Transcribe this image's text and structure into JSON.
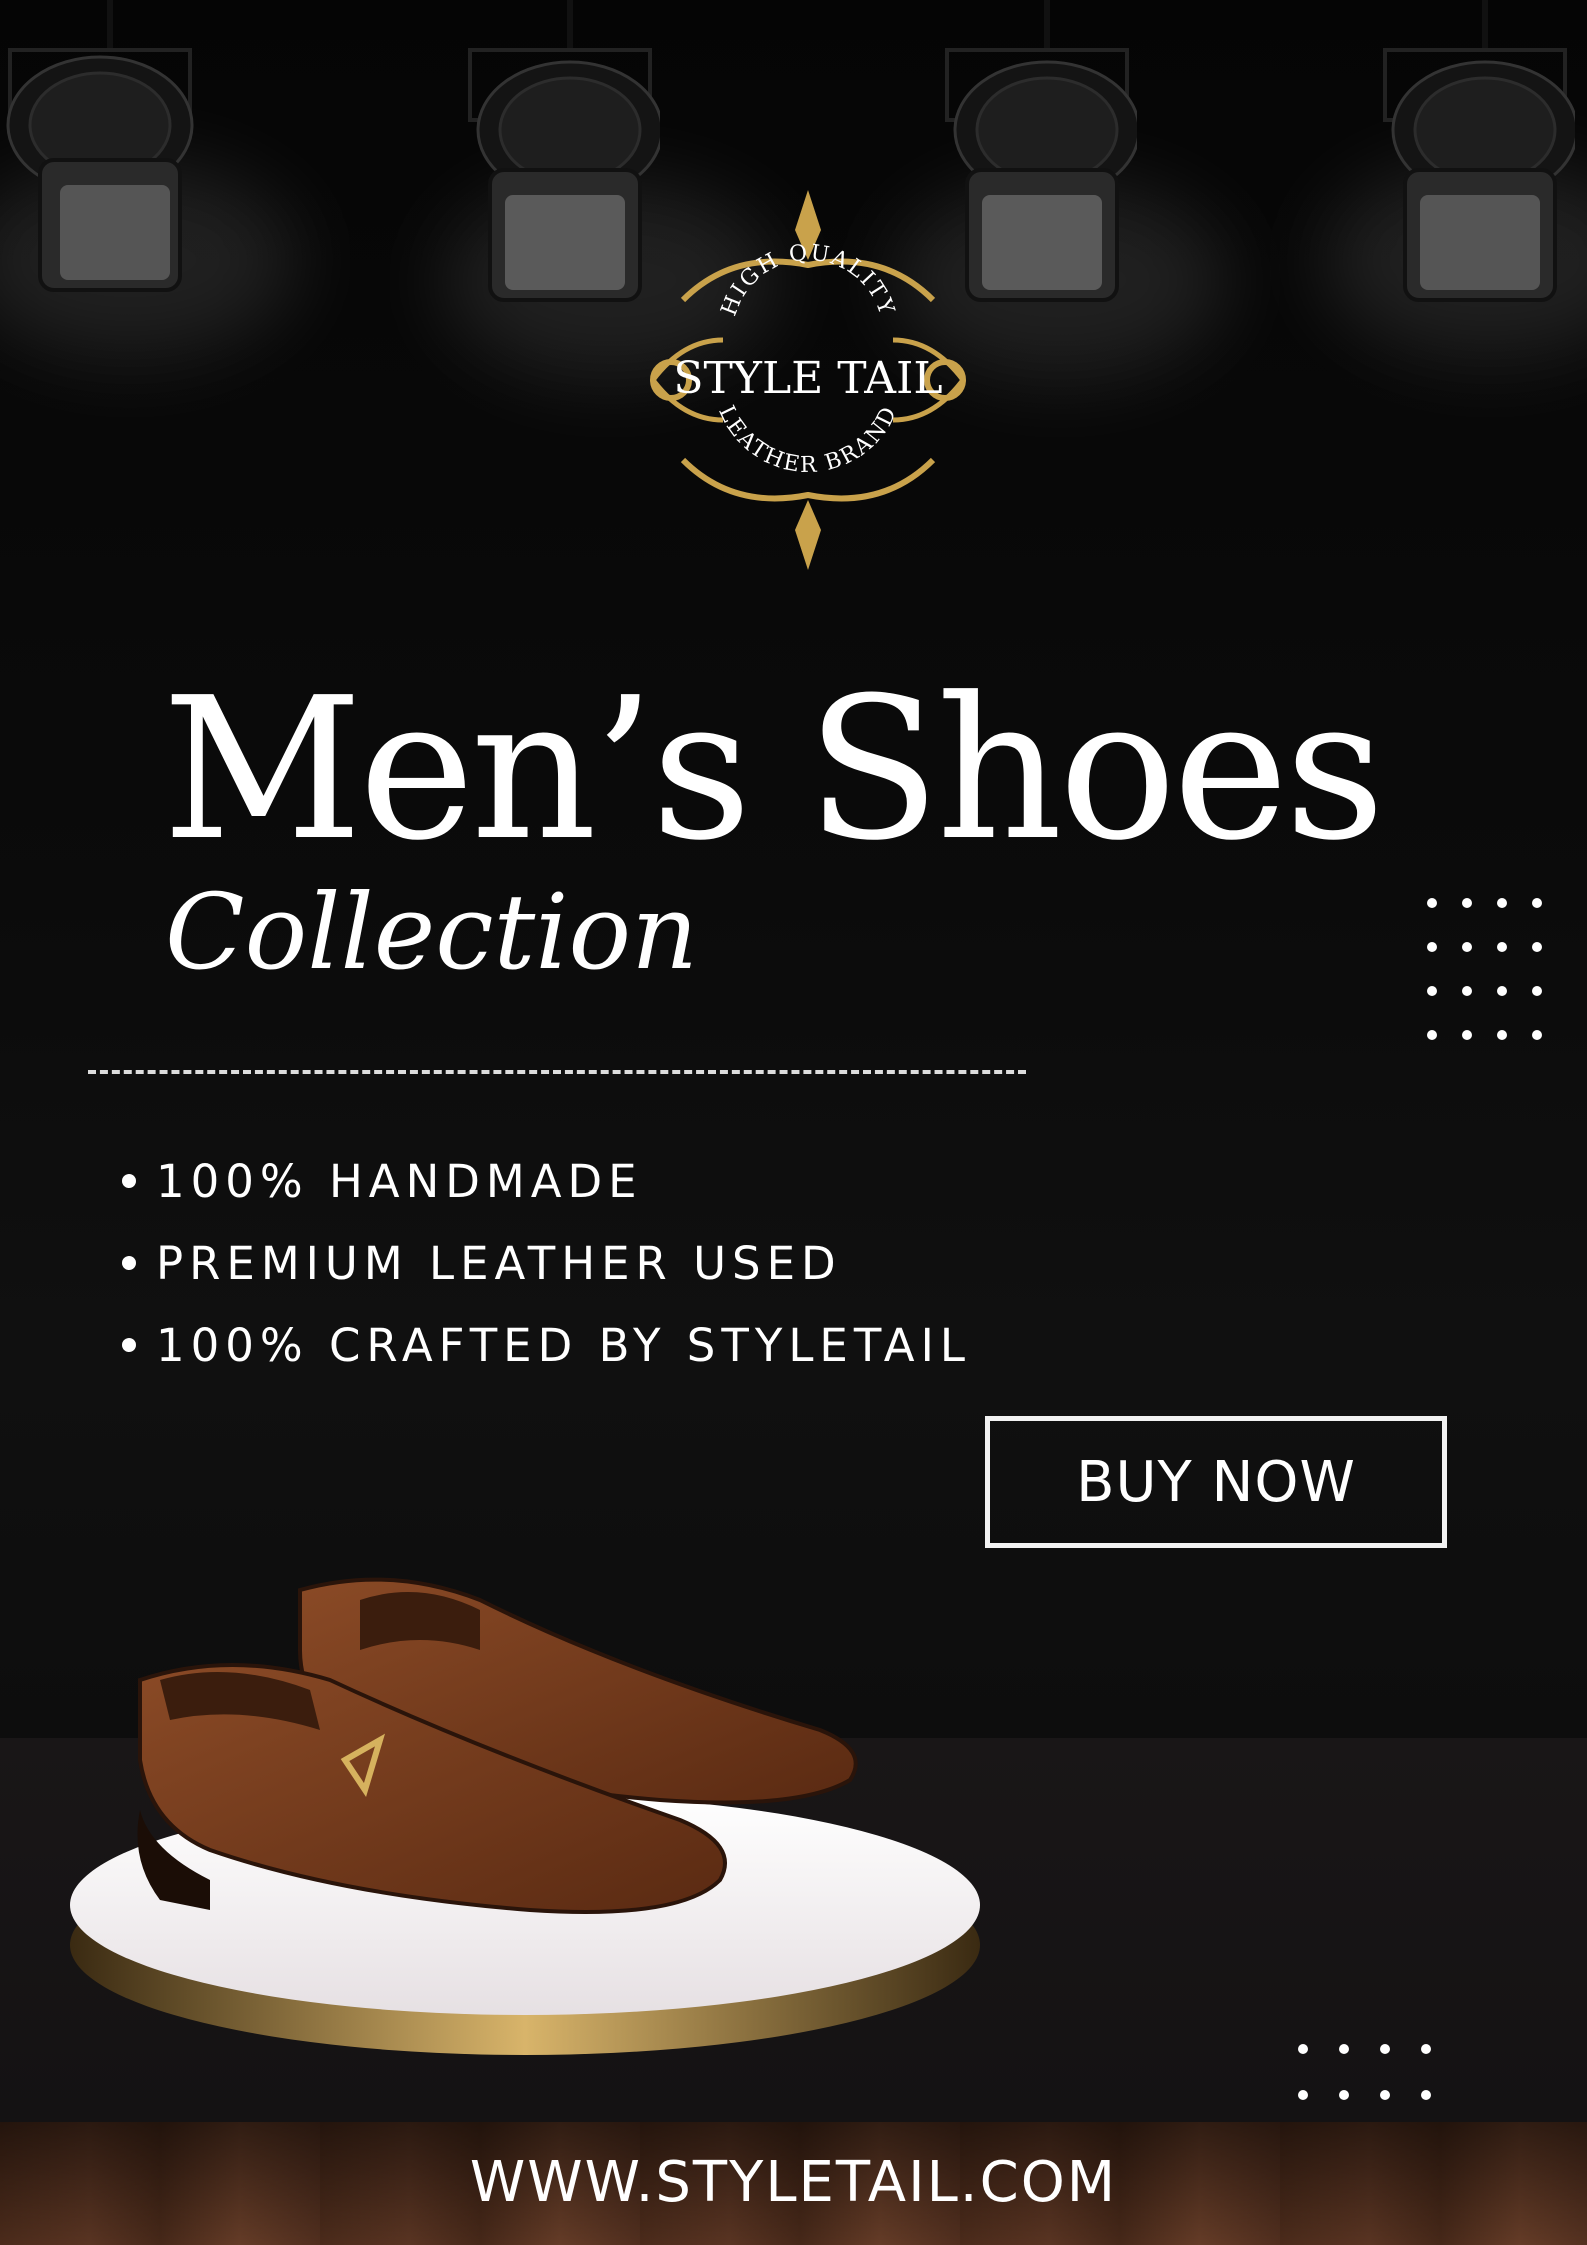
{
  "brand": {
    "top_text": "HIGH QUALITY",
    "name": "STYLE TAIL",
    "bottom_text": "LEATHER BRAND"
  },
  "headline": {
    "title": "Men’s Shoes",
    "subtitle": "Collection"
  },
  "features": [
    "100% HANDMADE",
    "PREMIUM LEATHER USED",
    "100% CRAFTED BY STYLETAIL"
  ],
  "cta": {
    "label": "BUY NOW"
  },
  "footer": {
    "website": "WWW.STYLETAIL.COM"
  },
  "colors": {
    "background": "#0b0b0b",
    "text": "#ffffff",
    "gold": "#c9a24b",
    "leather": "#7a3f1f",
    "wood": "#5a3322"
  },
  "icons": [
    "spotlight-icon",
    "brand-crest-icon",
    "bullet-dot-icon",
    "dot-grid-decoration"
  ]
}
